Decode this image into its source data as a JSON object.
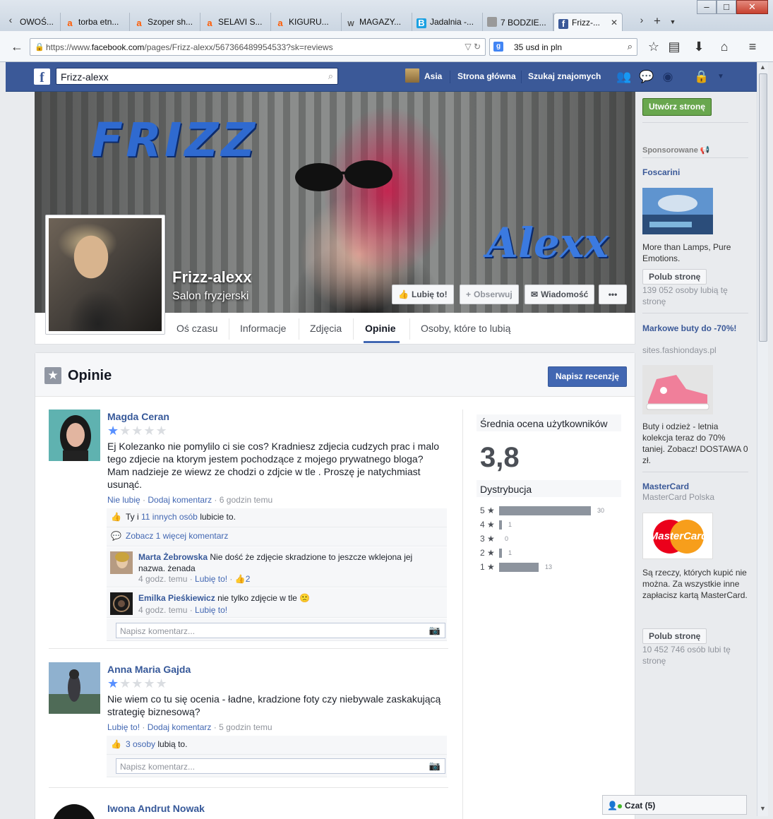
{
  "browser": {
    "tabs": [
      {
        "label": "OWOŚ...",
        "icon": "generic-page-icon",
        "color": "#777777"
      },
      {
        "label": "torba etn...",
        "icon": "allegro-icon",
        "color": "#ff5a00"
      },
      {
        "label": "Szoper sh...",
        "icon": "allegro-icon",
        "color": "#ff5a00"
      },
      {
        "label": "SELAVI S...",
        "icon": "allegro-icon",
        "color": "#ff5a00"
      },
      {
        "label": "KIGURU...",
        "icon": "allegro-icon",
        "color": "#ff5a00"
      },
      {
        "label": "MAGAZY...",
        "icon": "magazine-icon",
        "color": "#555555"
      },
      {
        "label": "Jadalnia -...",
        "icon": "b-icon",
        "color": "#1ba1e2"
      },
      {
        "label": "7 BODZIE...",
        "icon": "generic-page-icon",
        "color": "#777777"
      },
      {
        "label": "Frizz-...",
        "icon": "facebook-icon",
        "color": "#3b5998"
      }
    ],
    "url_prefix": "https://www.",
    "url_domain": "facebook.com",
    "url_path": "/pages/Frizz-alexx/567366489954533?sk=reviews",
    "search_value": "35 usd in pln"
  },
  "fbbar": {
    "search_value": "Frizz-alexx",
    "user_name": "Asia",
    "home_label": "Strona główna",
    "find_friends_label": "Szukaj znajomych"
  },
  "page": {
    "name": "Frizz-alexx",
    "category": "Salon fryzjerski",
    "cover_text_1": "FRIZZ",
    "cover_text_2": "Alexx",
    "like_button": "Lubię to!",
    "follow_button": "Obserwuj",
    "message_button": "Wiadomość",
    "more_button": "•••",
    "tabs": [
      "Oś czasu",
      "Informacje",
      "Zdjęcia",
      "Opinie",
      "Osoby, które to lubią"
    ],
    "active_tab": "Opinie"
  },
  "reviews": {
    "title": "Opinie",
    "write_button": "Napisz recenzję",
    "comment_placeholder": "Napisz komentarz...",
    "items": [
      {
        "author": "Magda Ceran",
        "rating": 1,
        "text": "Ej Kolezanko nie pomylilo ci sie cos? Kradniesz zdjecia cudzych prac i malo tego zdjecie na ktorym jestem pochodzące z mojego prywatnego bloga? Mam nadzieje ze wiewz ze chodzi o zdjcie w tle . Proszę je natychmiast usunąć.",
        "action_like": "Nie lubię",
        "action_comment": "Dodaj komentarz",
        "time": "6 godzin temu",
        "likes_prefix": "Ty i",
        "likes_link": "11 innych osób",
        "likes_suffix": "lubicie to.",
        "more_comments": "Zobacz 1 więcej komentarz",
        "comments": [
          {
            "author": "Marta Żebrowska",
            "text": "Nie dość że zdjęcie skradzione to jeszcze wklejona jej nazwa. żenada",
            "time": "4 godz. temu",
            "like": "Lubię to!",
            "likes": "2"
          },
          {
            "author": "Emilka Pieśkiewicz",
            "text": "nie tylko zdjęcie w tle",
            "emoticon": "🙁",
            "time": "4 godz. temu",
            "like": "Lubię to!"
          }
        ]
      },
      {
        "author": "Anna Maria Gajda",
        "rating": 1,
        "text": "Nie wiem co tu się ocenia - ładne, kradzione foty czy niebywale zaskakującą strategię biznesową?",
        "action_like": "Lubię to!",
        "action_comment": "Dodaj komentarz",
        "time": "5 godzin temu",
        "likes_link": "3 osoby",
        "likes_suffix": "lubią to."
      },
      {
        "author": "Iwona Andrut Nowak"
      }
    ]
  },
  "rating": {
    "avg_label": "Średnia ocena użytkowników",
    "avg_value": "3,8",
    "dist_label": "Dystrybucja",
    "rows": [
      {
        "label": "5 ★",
        "count": 30
      },
      {
        "label": "4 ★",
        "count": 1
      },
      {
        "label": "3 ★",
        "count": 0
      },
      {
        "label": "2 ★",
        "count": 1
      },
      {
        "label": "1 ★",
        "count": 13
      }
    ]
  },
  "sidebar": {
    "create_page": "Utwórz stronę",
    "sponsored": "Sponsorowane",
    "ads": [
      {
        "title": "Foscarini",
        "text": "More than Lamps, Pure Emotions.",
        "like": "Polub stronę",
        "count": "139 052 osoby lubią tę stronę"
      },
      {
        "title": "Markowe buty do -70%!",
        "sub": "sites.fashiondays.pl",
        "text": "Buty i odzież - letnia kolekcja teraz do 70% taniej. Zobacz! DOSTAWA 0 zł."
      },
      {
        "title": "MasterCard",
        "sub": "MasterCard Polska",
        "img_text": "MasterCard",
        "text": "Są rzeczy, których kupić nie można. Za wszystkie inne zapłacisz kartą MasterCard.",
        "like": "Polub stronę",
        "count": "10 452 746 osób lubi tę stronę"
      }
    ]
  },
  "chat": {
    "label": "Czat (5)"
  }
}
